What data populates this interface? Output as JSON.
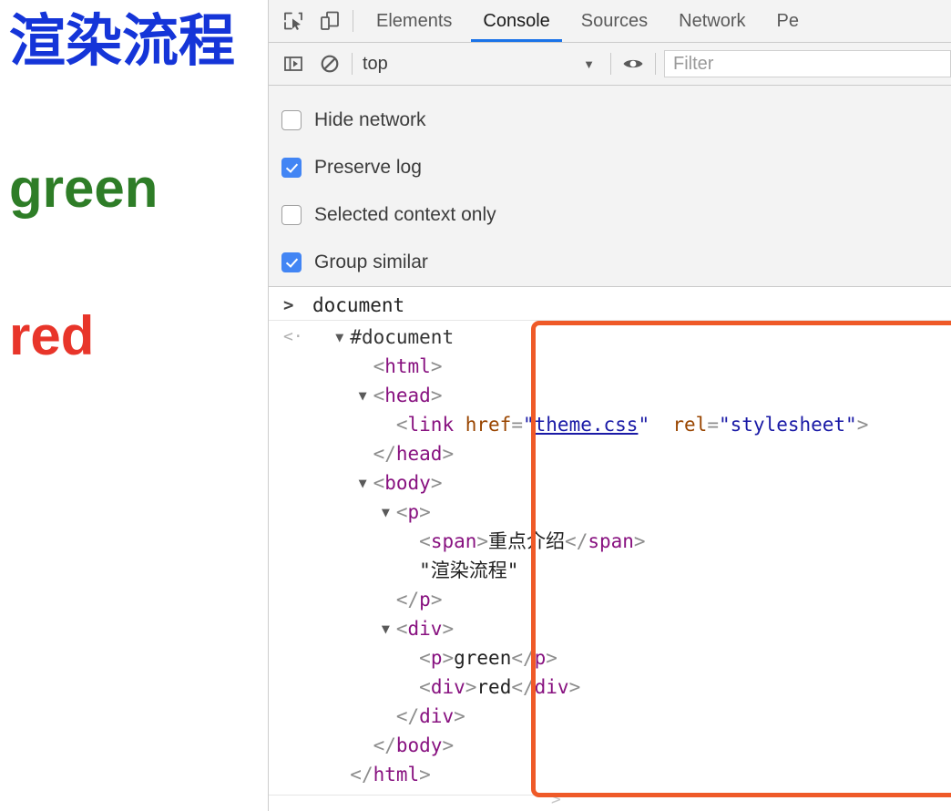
{
  "rendered_page": {
    "title_text": "渲染流程",
    "title_color": "#1535d8",
    "green_text": "green",
    "green_color": "#2e7d27",
    "red_text": "red",
    "red_color": "#e8352a"
  },
  "devtools": {
    "toolbar_icons": [
      {
        "name": "inspect-element-icon",
        "title": "Inspect element"
      },
      {
        "name": "device-toolbar-icon",
        "title": "Toggle device toolbar"
      }
    ],
    "tabs": [
      {
        "label": "Elements",
        "active": false
      },
      {
        "label": "Console",
        "active": true
      },
      {
        "label": "Sources",
        "active": false
      },
      {
        "label": "Network",
        "active": false
      },
      {
        "label": "Pe",
        "active": false
      }
    ],
    "active_tab_underline_color": "#1a73e8",
    "console_toolbar": {
      "sidebar_toggle_icon": "show-console-sidebar-icon",
      "clear_console_icon": "clear-console-icon",
      "context_value": "top",
      "context_caret": "▼",
      "eye_icon": "live-expression-eye-icon",
      "filter_placeholder": "Filter"
    },
    "settings": [
      {
        "label": "Hide network",
        "checked": false
      },
      {
        "label": "Preserve log",
        "checked": true
      },
      {
        "label": "Selected context only",
        "checked": false
      },
      {
        "label": "Group similar",
        "checked": true
      }
    ],
    "console": {
      "input_prompt": ">",
      "input_expression": "document",
      "output_prompt": "<·",
      "tree": [
        {
          "indent": 0,
          "triangle": "▼",
          "parts": [
            {
              "t": "#document",
              "c": "plain"
            }
          ]
        },
        {
          "indent": 1,
          "triangle": "",
          "parts": [
            {
              "t": "<",
              "c": "brack"
            },
            {
              "t": "html",
              "c": "tag"
            },
            {
              "t": ">",
              "c": "brack"
            }
          ]
        },
        {
          "indent": 1,
          "triangle": "▼",
          "parts": [
            {
              "t": "<",
              "c": "brack"
            },
            {
              "t": "head",
              "c": "tag"
            },
            {
              "t": ">",
              "c": "brack"
            }
          ]
        },
        {
          "indent": 2,
          "triangle": "",
          "parts": [
            {
              "t": "<",
              "c": "brack"
            },
            {
              "t": "link",
              "c": "tag"
            },
            {
              "t": " ",
              "c": "brack"
            },
            {
              "t": "href",
              "c": "attr"
            },
            {
              "t": "=",
              "c": "brack"
            },
            {
              "t": "\"",
              "c": "val"
            },
            {
              "t": "theme.css",
              "c": "link"
            },
            {
              "t": "\"",
              "c": "val"
            },
            {
              "t": "  ",
              "c": "brack"
            },
            {
              "t": "rel",
              "c": "attr"
            },
            {
              "t": "=",
              "c": "brack"
            },
            {
              "t": "\"stylesheet\"",
              "c": "val"
            },
            {
              "t": ">",
              "c": "brack"
            }
          ]
        },
        {
          "indent": 1,
          "triangle": "",
          "parts": [
            {
              "t": "</",
              "c": "brack"
            },
            {
              "t": "head",
              "c": "tag"
            },
            {
              "t": ">",
              "c": "brack"
            }
          ]
        },
        {
          "indent": 1,
          "triangle": "▼",
          "parts": [
            {
              "t": "<",
              "c": "brack"
            },
            {
              "t": "body",
              "c": "tag"
            },
            {
              "t": ">",
              "c": "brack"
            }
          ]
        },
        {
          "indent": 2,
          "triangle": "▼",
          "parts": [
            {
              "t": "<",
              "c": "brack"
            },
            {
              "t": "p",
              "c": "tag"
            },
            {
              "t": ">",
              "c": "brack"
            }
          ]
        },
        {
          "indent": 3,
          "triangle": "",
          "parts": [
            {
              "t": "<",
              "c": "brack"
            },
            {
              "t": "span",
              "c": "tag"
            },
            {
              "t": ">",
              "c": "brack"
            },
            {
              "t": "重点介绍",
              "c": "txt"
            },
            {
              "t": "</",
              "c": "brack"
            },
            {
              "t": "span",
              "c": "tag"
            },
            {
              "t": ">",
              "c": "brack"
            }
          ]
        },
        {
          "indent": 3,
          "triangle": "",
          "parts": [
            {
              "t": "\"渲染流程\"",
              "c": "strtxt"
            }
          ]
        },
        {
          "indent": 2,
          "triangle": "",
          "parts": [
            {
              "t": "</",
              "c": "brack"
            },
            {
              "t": "p",
              "c": "tag"
            },
            {
              "t": ">",
              "c": "brack"
            }
          ]
        },
        {
          "indent": 2,
          "triangle": "▼",
          "parts": [
            {
              "t": "<",
              "c": "brack"
            },
            {
              "t": "div",
              "c": "tag"
            },
            {
              "t": ">",
              "c": "brack"
            }
          ]
        },
        {
          "indent": 3,
          "triangle": "",
          "parts": [
            {
              "t": "<",
              "c": "brack"
            },
            {
              "t": "p",
              "c": "tag"
            },
            {
              "t": ">",
              "c": "brack"
            },
            {
              "t": "green",
              "c": "txt"
            },
            {
              "t": "</",
              "c": "brack"
            },
            {
              "t": "p",
              "c": "tag"
            },
            {
              "t": ">",
              "c": "brack"
            }
          ]
        },
        {
          "indent": 3,
          "triangle": "",
          "parts": [
            {
              "t": "<",
              "c": "brack"
            },
            {
              "t": "div",
              "c": "tag"
            },
            {
              "t": ">",
              "c": "brack"
            },
            {
              "t": "red",
              "c": "txt"
            },
            {
              "t": "</",
              "c": "brack"
            },
            {
              "t": "div",
              "c": "tag"
            },
            {
              "t": ">",
              "c": "brack"
            }
          ]
        },
        {
          "indent": 2,
          "triangle": "",
          "parts": [
            {
              "t": "</",
              "c": "brack"
            },
            {
              "t": "div",
              "c": "tag"
            },
            {
              "t": ">",
              "c": "brack"
            }
          ]
        },
        {
          "indent": 1,
          "triangle": "",
          "parts": [
            {
              "t": "</",
              "c": "brack"
            },
            {
              "t": "body",
              "c": "tag"
            },
            {
              "t": ">",
              "c": "brack"
            }
          ]
        },
        {
          "indent": 0,
          "triangle": "",
          "parts": [
            {
              "t": "</",
              "c": "brack"
            },
            {
              "t": "html",
              "c": "tag"
            },
            {
              "t": ">",
              "c": "brack"
            }
          ]
        }
      ],
      "bottom_prompt": ">"
    },
    "annotation": {
      "name": "orange-highlight-rect",
      "color": "#ef5a28"
    }
  }
}
